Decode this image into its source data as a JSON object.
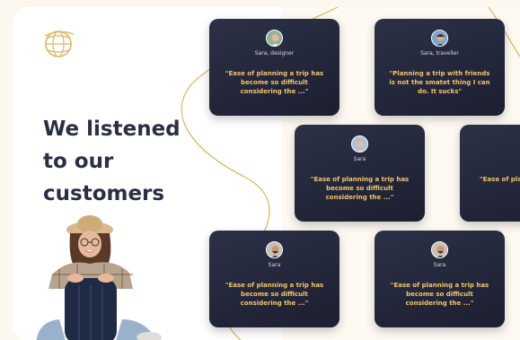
{
  "headline": [
    "We listened",
    "to our",
    "customers"
  ],
  "cards": [
    {
      "name": "Sara, designer",
      "quote": "\"Ease of planning a trip has become so difficult considering the ...\""
    },
    {
      "name": "Sara, traveller",
      "quote": "\"Planning a trip with friends is not the smatet thing I can do. It sucks\""
    },
    {
      "name": "Sara",
      "quote": "\"Ease of planning a trip has become so difficult considering the ...\""
    },
    {
      "name": "",
      "quote": "\"Ease of pla beco conside"
    },
    {
      "name": "Sara",
      "quote": "\"Ease of planning a trip has become so difficult considering the ...\""
    },
    {
      "name": "Sara",
      "quote": "\"Ease of planning a trip has become so difficult considering the ...\""
    }
  ],
  "colors": {
    "accent": "#f2c46b",
    "card_bg": "#23273a",
    "heading": "#2b2f45",
    "curve": "#e0b25a"
  },
  "icons": {
    "logo": "globe-logo-icon",
    "avatar": "user-avatar-icon"
  }
}
